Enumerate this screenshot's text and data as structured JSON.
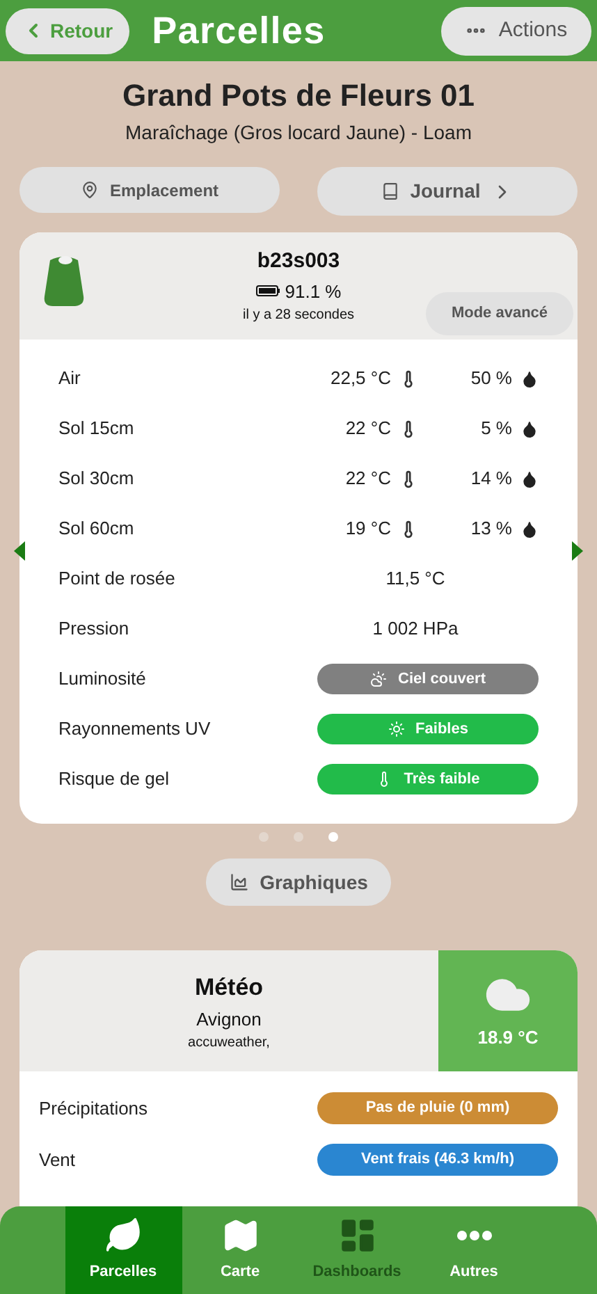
{
  "header": {
    "back": "Retour",
    "title": "Parcelles",
    "actions": "Actions"
  },
  "plot": {
    "name": "Grand Pots de Fleurs 01",
    "subtitle": "Maraîchage (Gros locard Jaune) - Loam"
  },
  "links": [
    {
      "label": "Emplacement",
      "kind": "location"
    },
    {
      "label": "Journal",
      "kind": "journal"
    }
  ],
  "sensor": {
    "id": "b23s003",
    "battery": "91.1 %",
    "updated": "il y a 28 secondes",
    "mode_button": "Mode avancé"
  },
  "measures": [
    {
      "kind": "pair",
      "label": "Air",
      "temp": "22,5 °C",
      "humidity": "50 %"
    },
    {
      "kind": "pair",
      "label": "Sol 15cm",
      "temp": "22 °C",
      "humidity": "5 %"
    },
    {
      "kind": "pair",
      "label": "Sol 30cm",
      "temp": "22 °C",
      "humidity": "14 %"
    },
    {
      "kind": "pair",
      "label": "Sol 60cm",
      "temp": "19 °C",
      "humidity": "13 %"
    },
    {
      "kind": "single",
      "label": "Point de rosée",
      "value": "11,5 °C"
    },
    {
      "kind": "single",
      "label": "Pression",
      "value": "1 002 HPa"
    },
    {
      "kind": "badge",
      "label": "Luminosité",
      "value": "Ciel couvert",
      "color": "#808080"
    },
    {
      "kind": "badge",
      "label": "Rayonnements UV",
      "value": "Faibles",
      "color": "#22bb4a"
    },
    {
      "kind": "badge",
      "label": "Risque de gel",
      "value": "Très faible",
      "color": "#22bb4a"
    }
  ],
  "pager": [
    {
      "selected": false
    },
    {
      "selected": false
    },
    {
      "selected": true
    }
  ],
  "charts_button": "Graphiques",
  "weather": {
    "title": "Météo",
    "city": "Avignon",
    "source": "accuweather,",
    "temperature": "18.9 °C",
    "rows": [
      {
        "label": "Précipitations",
        "value": "Pas de pluie (0 mm)",
        "color": "#cc8c35"
      },
      {
        "label": "Vent",
        "value": "Vent frais (46.3 km/h)",
        "color": "#2a86d1"
      }
    ]
  },
  "nav": [
    {
      "label": "Parcelles",
      "selected": true,
      "disabled": false
    },
    {
      "label": "Carte",
      "selected": false,
      "disabled": false
    },
    {
      "label": "Dashboards",
      "selected": false,
      "disabled": true
    },
    {
      "label": "Autres",
      "selected": false,
      "disabled": false
    }
  ]
}
